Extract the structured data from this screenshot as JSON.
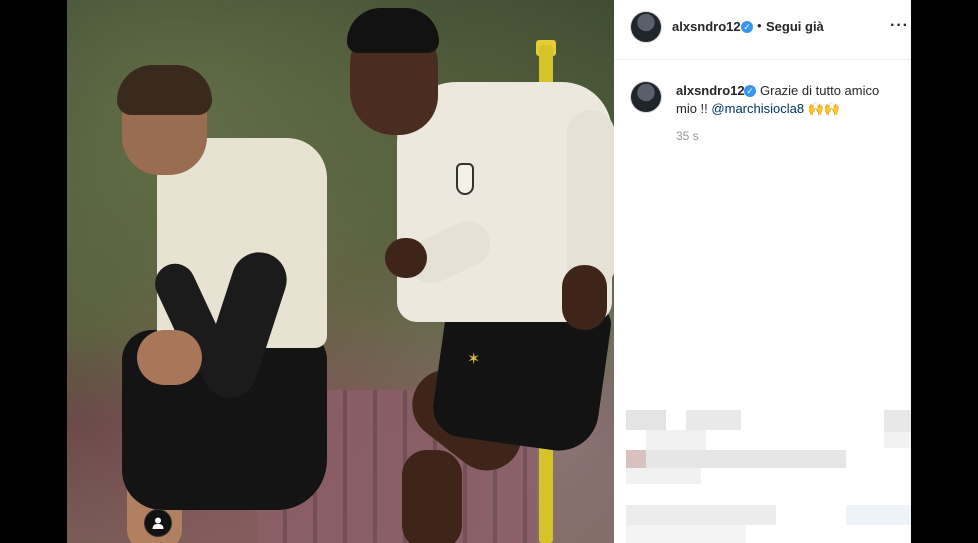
{
  "post": {
    "username": "alxsndro12",
    "follow_status": "Segui già",
    "separator": "•",
    "more_label": "···",
    "caption_prefix": "Grazie di tutto amico mio !!",
    "mention": "@marchisiocla8",
    "caption_emoji": "🙌🙌",
    "timestamp": "35 s"
  },
  "icons": {
    "verified": "verified-badge-icon",
    "user": "user-profile-icon",
    "more": "more-options-icon"
  },
  "colors": {
    "verified_blue": "#3897f0",
    "mention": "#003569",
    "text": "#262626",
    "muted": "#999999"
  }
}
